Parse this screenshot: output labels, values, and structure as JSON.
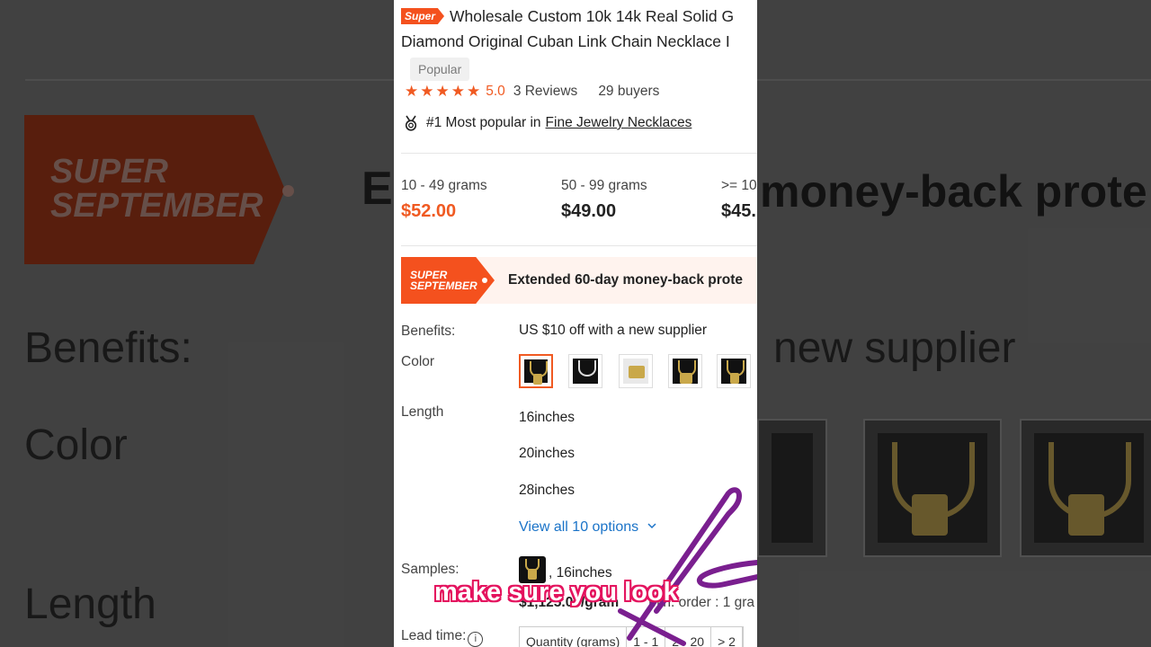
{
  "product": {
    "badge": "Super",
    "title_line1": "Wholesale Custom 10k 14k Real Solid G",
    "title_line2": "Diamond Original Cuban Link Chain Necklace I",
    "popular_tag": "Popular",
    "rating": "5.0",
    "reviews": "3 Reviews",
    "buyers": "29 buyers",
    "rank_text": "#1 Most popular in",
    "rank_category": "Fine Jewelry Necklaces"
  },
  "price_tiers": [
    {
      "range": "10 - 49 grams",
      "price": "$52.00"
    },
    {
      "range": "50 - 99 grams",
      "price": "$49.00"
    },
    {
      "range": ">= 10",
      "price": "$45."
    }
  ],
  "promo": {
    "tag_line1": "SUPER",
    "tag_line2": "SEPTEMBER",
    "text": "Extended 60-day money-back prote"
  },
  "benefits": {
    "label": "Benefits:",
    "value": "US $10 off with a new supplier"
  },
  "color": {
    "label": "Color",
    "selected_index": 0,
    "swatch_count": 5
  },
  "length": {
    "label": "Length",
    "options": [
      "16inches",
      "20inches",
      "28inches"
    ],
    "view_all": "View all 10 options"
  },
  "samples": {
    "label": "Samples:",
    "value": ", 16inches",
    "price": "$1,125.00/gram",
    "min_order": "Min. order : 1 gra"
  },
  "lead_time": {
    "label": "Lead time:",
    "info_glyph": "i",
    "table_headers": [
      "Quantity (grams)",
      "1 - 1",
      "2 - 20",
      "> 2"
    ]
  },
  "background": {
    "tag_line1": "SUPER",
    "tag_line2": "SEPTEMBER",
    "e_letter": "E",
    "headline": "money-back prote",
    "benefits": "Benefits:",
    "supplier": "new supplier",
    "color": "Color",
    "length": "Length"
  },
  "caption": "make sure you look",
  "colors": {
    "accent": "#f05a22",
    "link": "#1a73c8",
    "arrow": "#7a1f8f",
    "caption_outline": "#e4145f"
  }
}
